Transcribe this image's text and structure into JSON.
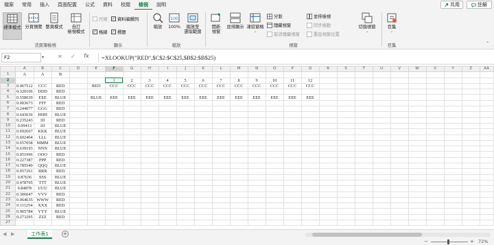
{
  "menu": [
    "檔案",
    "常用",
    "插入",
    "頁面配置",
    "公式",
    "資料",
    "校閱",
    "檢視",
    "說明"
  ],
  "active_menu": "檢視",
  "share_label": "共用",
  "comment_label": "註解",
  "ribbon": {
    "normal": "標準模式",
    "page_break_preview": "分頁預覽",
    "page_layout": "整頁模式",
    "custom_views": "自訂\n檢視模式",
    "group_workbook_views": "活頁簿檢視",
    "ruler": "尺規",
    "formula_bar": "資料編輯列",
    "gridlines": "格線",
    "headings": "標題",
    "group_show": "顯示",
    "zoom": "縮放",
    "zoom_100": "100%",
    "zoom_to_selection": "縮放至\n選取範圍",
    "group_zoom": "縮放",
    "new_window": "開新\n視窗",
    "arrange_all": "並排顯示",
    "freeze_panes": "凍結窗格",
    "split": "分割",
    "hide": "隱藏視窗",
    "unhide": "取消隱藏視窗",
    "view_side_by_side": "並排檢視",
    "synchronous_scrolling": "同步捲動",
    "reset_window_position": "重設視窗位置",
    "switch_windows": "切換視窗",
    "group_window": "視窗",
    "macros": "巨集",
    "group_macros": "巨集"
  },
  "formula_bar": {
    "name_box": "F2",
    "cancel": "✕",
    "enter": "✓",
    "fx": "fx",
    "formula": "=XLOOKUP(\"RED\",$C$2:$C$25,$B$2:$B$25)"
  },
  "columns": [
    "A",
    "B",
    "C",
    "D",
    "E",
    "F",
    "G",
    "H",
    "I",
    "J",
    "K",
    "L",
    "M",
    "N",
    "O",
    "P",
    "Q",
    "R",
    "S",
    "T",
    "U",
    "V",
    "W",
    "X",
    "Y",
    "Z",
    "AA"
  ],
  "rows": [
    [
      "A",
      "A",
      "B",
      "",
      "",
      "",
      "",
      "",
      "",
      "",
      "",
      "",
      "",
      "",
      "",
      "",
      ""
    ],
    [
      "",
      "",
      "",
      "",
      "",
      "1",
      "2",
      "3",
      "4",
      "5",
      "6",
      "7",
      "8",
      "9",
      "10",
      "11",
      "12"
    ],
    [
      "0.067512",
      "CCC",
      "RED",
      "",
      "RED",
      "CCC",
      "CCC",
      "CCC",
      "CCC",
      "CCC",
      "CCC",
      "CCC",
      "CCC",
      "CCC",
      "CCC",
      "CCC",
      "CCC"
    ],
    [
      "0.320106",
      "DDD",
      "RED",
      "",
      "",
      "",
      "",
      "",
      "",
      "",
      "",
      "",
      "",
      "",
      "",
      "",
      ""
    ],
    [
      "0.558039",
      "EEE",
      "BLUE",
      "",
      "BLUE",
      "EEE",
      "EEE",
      "EEE",
      "EEE",
      "EEE",
      "EEE",
      "EEE",
      "EEE",
      "EEE",
      "EEE",
      "EEE",
      "EEE"
    ],
    [
      "0.003673",
      "FFF",
      "RED",
      "",
      "",
      "",
      "",
      "",
      "",
      "",
      "",
      "",
      "",
      "",
      "",
      "",
      ""
    ],
    [
      "0.244077",
      "GGG",
      "RED",
      "",
      "",
      "",
      "",
      "",
      "",
      "",
      "",
      "",
      "",
      "",
      "",
      "",
      ""
    ],
    [
      "0.643636",
      "HHH",
      "BLUE",
      "",
      "",
      "",
      "",
      "",
      "",
      "",
      "",
      "",
      "",
      "",
      "",
      "",
      ""
    ],
    [
      "0.235243",
      "III",
      "RED",
      "",
      "",
      "",
      "",
      "",
      "",
      "",
      "",
      "",
      "",
      "",
      "",
      "",
      ""
    ],
    [
      "0.99413",
      "JJJ",
      "BLUE",
      "",
      "",
      "",
      "",
      "",
      "",
      "",
      "",
      "",
      "",
      "",
      "",
      "",
      ""
    ],
    [
      "0.692667",
      "KKK",
      "BLUE",
      "",
      "",
      "",
      "",
      "",
      "",
      "",
      "",
      "",
      "",
      "",
      "",
      "",
      ""
    ],
    [
      "0.602404",
      "LLL",
      "BLUE",
      "",
      "",
      "",
      "",
      "",
      "",
      "",
      "",
      "",
      "",
      "",
      "",
      "",
      ""
    ],
    [
      "0.657058",
      "MMM",
      "BLUE",
      "",
      "",
      "",
      "",
      "",
      "",
      "",
      "",
      "",
      "",
      "",
      "",
      "",
      ""
    ],
    [
      "0.639193",
      "NNN",
      "BLUE",
      "",
      "",
      "",
      "",
      "",
      "",
      "",
      "",
      "",
      "",
      "",
      "",
      "",
      ""
    ],
    [
      "0.051996",
      "OOO",
      "RED",
      "",
      "",
      "",
      "",
      "",
      "",
      "",
      "",
      "",
      "",
      "",
      "",
      "",
      ""
    ],
    [
      "0.227387",
      "PPP",
      "RED",
      "",
      "",
      "",
      "",
      "",
      "",
      "",
      "",
      "",
      "",
      "",
      "",
      "",
      ""
    ],
    [
      "0.785549",
      "QQQ",
      "BLUE",
      "",
      "",
      "",
      "",
      "",
      "",
      "",
      "",
      "",
      "",
      "",
      "",
      "",
      ""
    ],
    [
      "0.057261",
      "RRR",
      "RED",
      "",
      "",
      "",
      "",
      "",
      "",
      "",
      "",
      "",
      "",
      "",
      "",
      "",
      ""
    ],
    [
      "0.87636",
      "SSS",
      "BLUE",
      "",
      "",
      "",
      "",
      "",
      "",
      "",
      "",
      "",
      "",
      "",
      "",
      "",
      ""
    ],
    [
      "0.478795",
      "TTT",
      "BLUE",
      "",
      "",
      "",
      "",
      "",
      "",
      "",
      "",
      "",
      "",
      "",
      "",
      "",
      ""
    ],
    [
      "0.84878",
      "UUU",
      "BLUE",
      "",
      "",
      "",
      "",
      "",
      "",
      "",
      "",
      "",
      "",
      "",
      "",
      "",
      ""
    ],
    [
      "0.306047",
      "VVV",
      "RED",
      "",
      "",
      "",
      "",
      "",
      "",
      "",
      "",
      "",
      "",
      "",
      "",
      "",
      ""
    ],
    [
      "0.064635",
      "WWW",
      "RED",
      "",
      "",
      "",
      "",
      "",
      "",
      "",
      "",
      "",
      "",
      "",
      "",
      "",
      ""
    ],
    [
      "0.111254",
      "XXX",
      "RED",
      "",
      "",
      "",
      "",
      "",
      "",
      "",
      "",
      "",
      "",
      "",
      "",
      "",
      ""
    ],
    [
      "0.905784",
      "YYY",
      "BLUE",
      "",
      "",
      "",
      "",
      "",
      "",
      "",
      "",
      "",
      "",
      "",
      "",
      "",
      ""
    ],
    [
      "0.273295",
      "ZZZ",
      "RED",
      "",
      "",
      "",
      "",
      "",
      "",
      "",
      "",
      "",
      "",
      "",
      "",
      "",
      ""
    ],
    [
      "",
      "",
      "",
      "",
      "",
      "",
      "",
      "",
      "",
      "",
      "",
      "",
      "",
      "",
      "",
      "",
      ""
    ]
  ],
  "sheet_tab": "工作表1",
  "zoom_level": "72%",
  "colors": {
    "accent": "#107c41"
  }
}
